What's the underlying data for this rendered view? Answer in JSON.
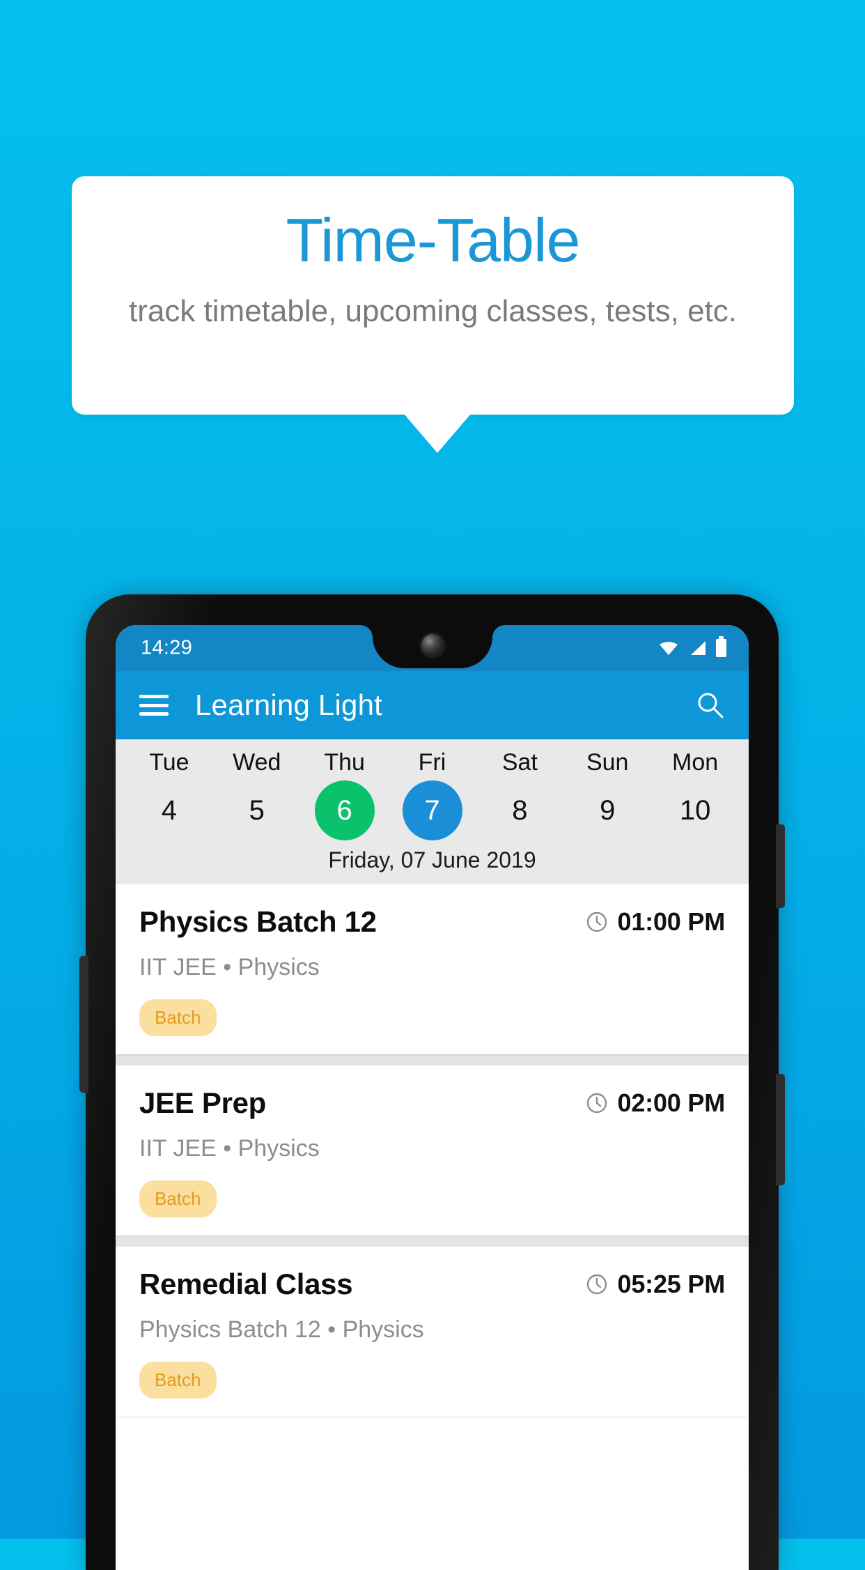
{
  "promo": {
    "title": "Time-Table",
    "subtitle": "track timetable, upcoming classes, tests, etc."
  },
  "colors": {
    "background_top": "#05c0ee",
    "background_bottom": "#0499e1",
    "promo_title": "#1b97d8",
    "app_bar": "#0d97d8",
    "status_bar": "#1386c6",
    "today_pill": "#0bc26c",
    "selected_pill": "#1a8fd8",
    "chip_background": "#fbdf9f",
    "chip_text": "#e49b22"
  },
  "phone": {
    "status_bar": {
      "time": "14:29",
      "icons": [
        "wifi-icon",
        "signal-icon",
        "battery-icon"
      ]
    },
    "app_bar": {
      "menu_icon": "hamburger-menu-icon",
      "title": "Learning Light",
      "search_icon": "search-icon"
    },
    "date_strip": {
      "days": [
        {
          "day": "Tue",
          "num": "4",
          "state": "normal"
        },
        {
          "day": "Wed",
          "num": "5",
          "state": "normal"
        },
        {
          "day": "Thu",
          "num": "6",
          "state": "today"
        },
        {
          "day": "Fri",
          "num": "7",
          "state": "selected"
        },
        {
          "day": "Sat",
          "num": "8",
          "state": "normal"
        },
        {
          "day": "Sun",
          "num": "9",
          "state": "normal"
        },
        {
          "day": "Mon",
          "num": "10",
          "state": "normal"
        }
      ],
      "full_date": "Friday, 07 June 2019"
    },
    "classes": [
      {
        "title": "Physics Batch 12",
        "time": "01:00 PM",
        "subtitle": "IIT JEE • Physics",
        "chip": "Batch"
      },
      {
        "title": "JEE Prep",
        "time": "02:00 PM",
        "subtitle": "IIT JEE • Physics",
        "chip": "Batch"
      },
      {
        "title": "Remedial Class",
        "time": "05:25 PM",
        "subtitle": "Physics Batch 12 • Physics",
        "chip": "Batch"
      }
    ]
  }
}
